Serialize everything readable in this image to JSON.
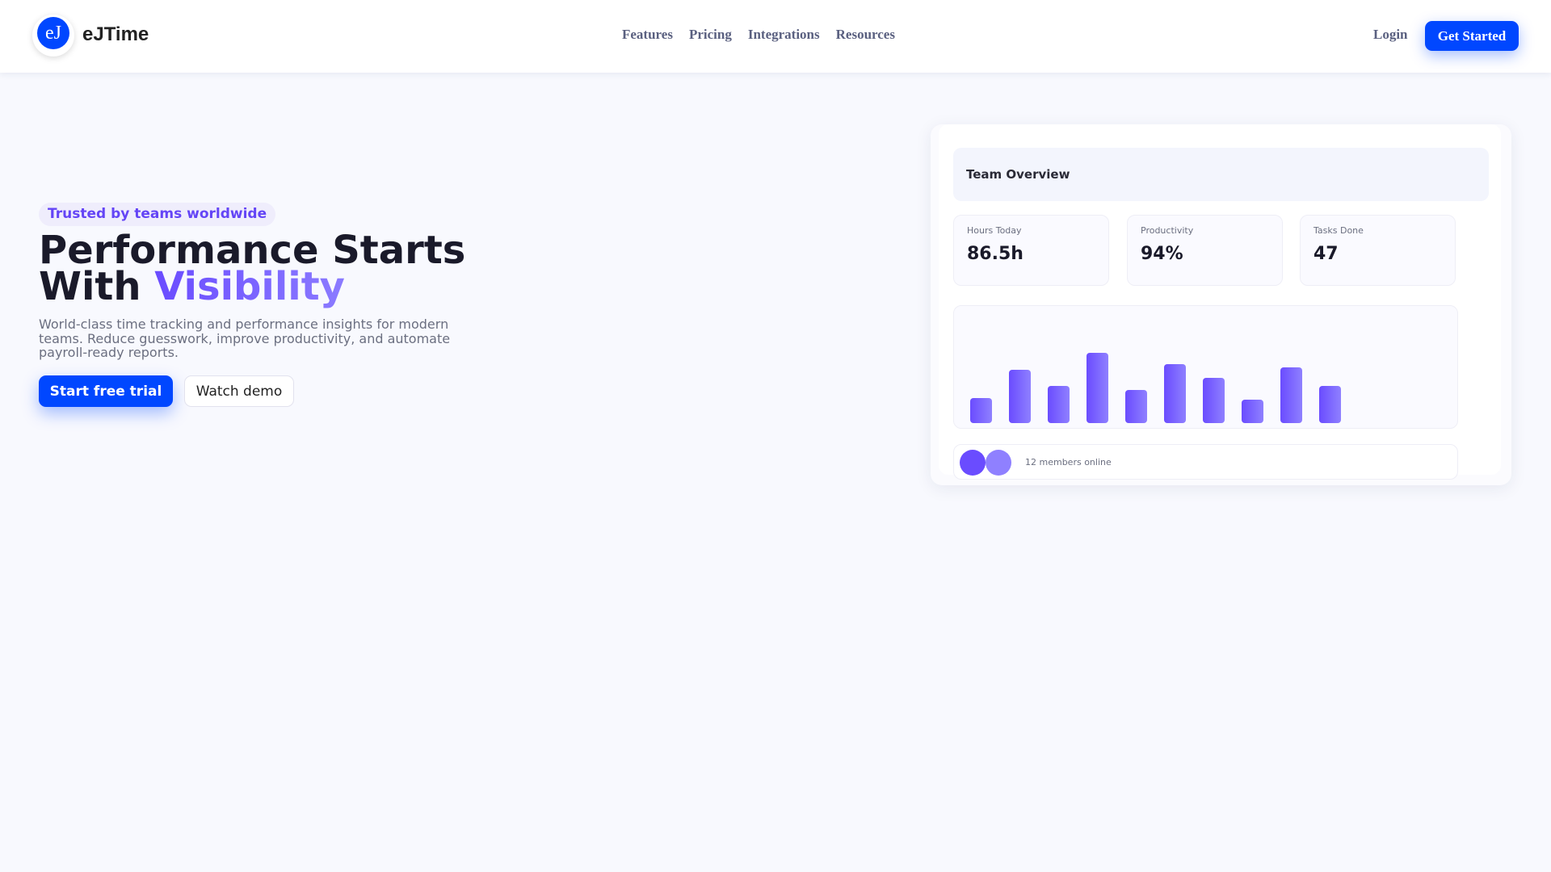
{
  "nav": {
    "logo": "eJ",
    "brand": "eJTime",
    "links": [
      "Features",
      "Pricing",
      "Integrations",
      "Resources"
    ],
    "login": "Login",
    "cta": "Get Started"
  },
  "hero": {
    "badge": "Trusted by teams worldwide",
    "title_line1": "Performance Starts",
    "title_with": "With ",
    "title_highlight": "Visibility",
    "description": "World-class time tracking and performance insights for modern teams. Reduce guesswork, improve productivity, and automate payroll-ready reports.",
    "primary": "Start free trial",
    "secondary": "Watch demo"
  },
  "dashboard": {
    "title": "Team Overview",
    "stats": [
      {
        "label": "Hours Today",
        "value": "86.5h"
      },
      {
        "label": "Productivity",
        "value": "94%"
      },
      {
        "label": "Tasks Done",
        "value": "47"
      }
    ],
    "members": "12 members online",
    "avatar_colors": [
      "#6a4cff",
      "#8f80ff"
    ]
  },
  "chart_data": {
    "type": "bar",
    "values": [
      30,
      65,
      45,
      85,
      40,
      72,
      55,
      28,
      68,
      45
    ],
    "ylim": [
      0,
      100
    ]
  }
}
